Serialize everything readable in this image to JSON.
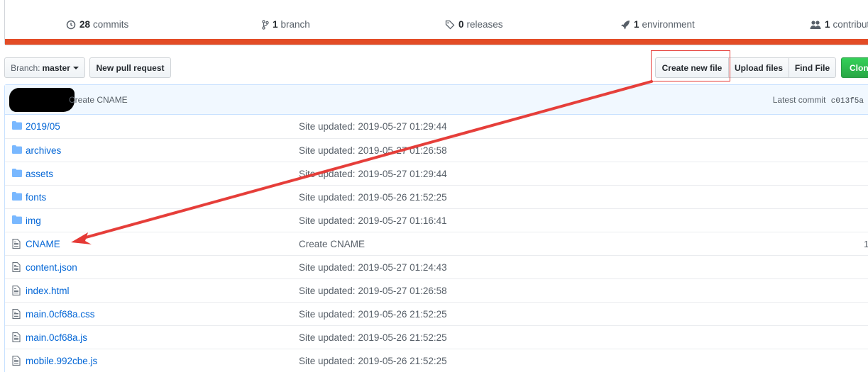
{
  "summary": {
    "commits": {
      "count": "28",
      "label": "commits",
      "icon": "history-icon"
    },
    "branches": {
      "count": "1",
      "label": "branch",
      "icon": "git-branch-icon"
    },
    "releases": {
      "count": "0",
      "label": "releases",
      "icon": "tag-icon"
    },
    "environments": {
      "count": "1",
      "label": "environment",
      "icon": "rocket-icon"
    },
    "contributors": {
      "count": "1",
      "label": "contribut",
      "icon": "people-icon"
    },
    "language_bar_color": "#e34c26"
  },
  "toolbar": {
    "branch_prefix": "Branch:",
    "branch_name": "master",
    "new_pull_request": "New pull request",
    "create_new_file": "Create new file",
    "upload_files": "Upload files",
    "find_file": "Find File",
    "clone": "Clone"
  },
  "commit_bar": {
    "message": "Create CNAME",
    "latest_label": "Latest commit",
    "sha": "c013f5a"
  },
  "files": [
    {
      "type": "folder",
      "name": "2019/05",
      "message": "Site updated: 2019-05-27 01:29:44",
      "age": ""
    },
    {
      "type": "folder",
      "name": "archives",
      "message": "Site updated: 2019-05-27 01:26:58",
      "age": ""
    },
    {
      "type": "folder",
      "name": "assets",
      "message": "Site updated: 2019-05-27 01:29:44",
      "age": ""
    },
    {
      "type": "folder",
      "name": "fonts",
      "message": "Site updated: 2019-05-26 21:52:25",
      "age": ""
    },
    {
      "type": "folder",
      "name": "img",
      "message": "Site updated: 2019-05-27 01:16:41",
      "age": ""
    },
    {
      "type": "file",
      "name": "CNAME",
      "message": "Create CNAME",
      "age": "1"
    },
    {
      "type": "file",
      "name": "content.json",
      "message": "Site updated: 2019-05-27 01:24:43",
      "age": ""
    },
    {
      "type": "file",
      "name": "index.html",
      "message": "Site updated: 2019-05-27 01:26:58",
      "age": ""
    },
    {
      "type": "file",
      "name": "main.0cf68a.css",
      "message": "Site updated: 2019-05-26 21:52:25",
      "age": ""
    },
    {
      "type": "file",
      "name": "main.0cf68a.js",
      "message": "Site updated: 2019-05-26 21:52:25",
      "age": ""
    },
    {
      "type": "file",
      "name": "mobile.992cbe.js",
      "message": "Site updated: 2019-05-26 21:52:25",
      "age": ""
    }
  ],
  "annotation_color": "#e53935"
}
